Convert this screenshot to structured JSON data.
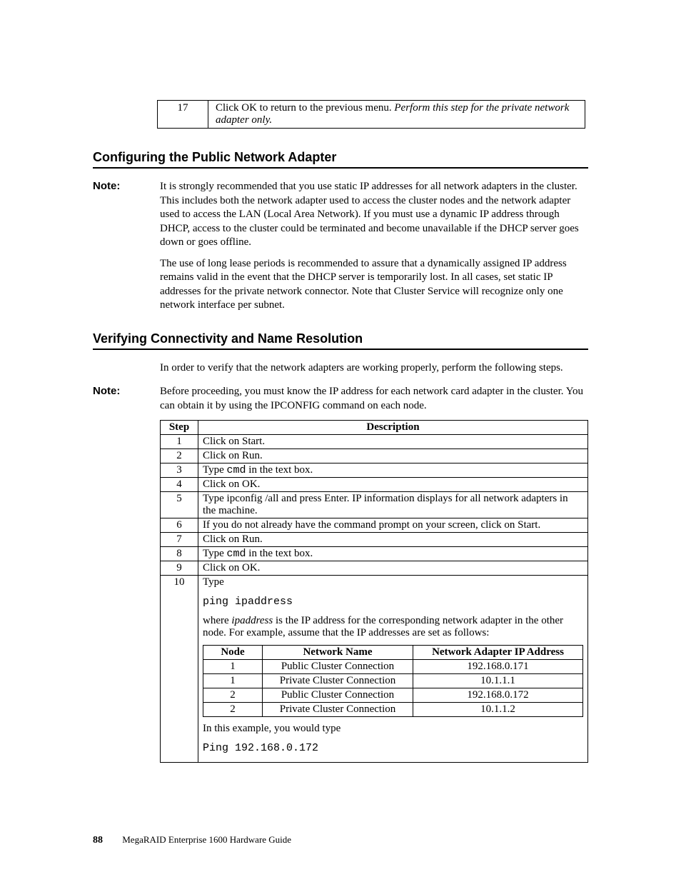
{
  "toptable": {
    "step": "17",
    "text_plain": "Click OK to return to the previous menu. ",
    "text_italic": "Perform this step for the private network adapter only."
  },
  "section1": {
    "heading": "Configuring the Public Network Adapter",
    "note_label": "Note:",
    "note_text": "It is strongly recommended that you use static IP addresses for all network adapters in the cluster. This includes both the network adapter used to access the cluster nodes and the network adapter used to access the LAN (Local Area Network).  If you must use a dynamic IP address through DHCP, access to the cluster could be terminated and become unavailable if the DHCP server goes down or goes offline.",
    "para2": "The use of long lease periods is recommended to assure that a dynamically assigned IP address remains valid in the event that the DHCP server is temporarily lost. In all cases, set static IP addresses for the private network connector. Note that Cluster Service will recognize only one network interface per subnet."
  },
  "section2": {
    "heading": "Verifying Connectivity and Name Resolution",
    "intro": "In order to verify that the network adapters are working properly, perform the following steps.",
    "note_label": "Note:",
    "note_text": "Before proceeding, you must know the IP address for each network card adapter in the cluster. You can obtain it by using the IPCONFIG command on each node.",
    "table": {
      "h_step": "Step",
      "h_desc": "Description",
      "rows": [
        {
          "n": "1",
          "d": "Click on Start."
        },
        {
          "n": "2",
          "d": "Click on Run."
        },
        {
          "n": "3",
          "d_pre": "Type ",
          "d_mono": "cmd",
          "d_post": " in the text box."
        },
        {
          "n": "4",
          "d": "Click on OK."
        },
        {
          "n": "5",
          "d": "Type ipconfig /all and press Enter. IP information displays for all network adapters in the machine."
        },
        {
          "n": "6",
          "d": "If you do not already have the command prompt on your screen, click on Start."
        },
        {
          "n": "7",
          "d": "Click on Run."
        },
        {
          "n": "8",
          "d_pre": "Type ",
          "d_mono": "cmd",
          "d_post": " in the text box."
        },
        {
          "n": "9",
          "d": "Click on OK."
        }
      ],
      "row10": {
        "n": "10",
        "line1": "Type",
        "line2_mono": "ping ipaddress",
        "line3_pre": "where ",
        "line3_italic": "ipaddress",
        "line3_post": " is the IP address for the corresponding network adapter in the other node. For example, assume that the IP addresses are set as follows:",
        "inner": {
          "h1": "Node",
          "h2": "Network Name",
          "h3": "Network Adapter IP Address",
          "r": [
            {
              "a": "1",
              "b": "Public Cluster Connection",
              "c": "192.168.0.171"
            },
            {
              "a": "1",
              "b": "Private Cluster Connection",
              "c": "10.1.1.1"
            },
            {
              "a": "2",
              "b": "Public Cluster Connection",
              "c": "192.168.0.172"
            },
            {
              "a": "2",
              "b": "Private Cluster Connection",
              "c": "10.1.1.2"
            }
          ]
        },
        "line4": "In this example, you would type",
        "line5_mono": "Ping 192.168.0.172"
      }
    }
  },
  "footer": {
    "page": "88",
    "title": "MegaRAID Enterprise 1600 Hardware Guide"
  }
}
